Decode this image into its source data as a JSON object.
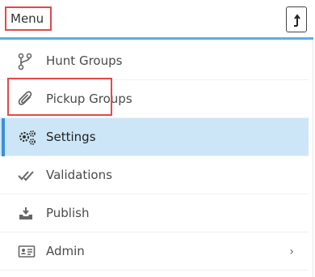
{
  "header": {
    "title": "Menu",
    "collapse_icon": "arrow-up-icon"
  },
  "menu": {
    "items": [
      {
        "label": "Hunt Groups",
        "icon": "branch-icon"
      },
      {
        "label": "Pickup Groups",
        "icon": "paperclip-icon"
      },
      {
        "label": "Settings",
        "icon": "gears-icon",
        "active": true
      },
      {
        "label": "Validations",
        "icon": "double-check-icon"
      },
      {
        "label": "Publish",
        "icon": "download-tray-icon"
      },
      {
        "label": "Admin",
        "icon": "id-card-icon",
        "has_submenu": true
      }
    ],
    "submenu_indicator": "›"
  },
  "colors": {
    "accent": "#5aaee3",
    "active_bg": "#cce6f7",
    "active_bar": "#3b8fd9",
    "highlight": "#e04a4a"
  }
}
